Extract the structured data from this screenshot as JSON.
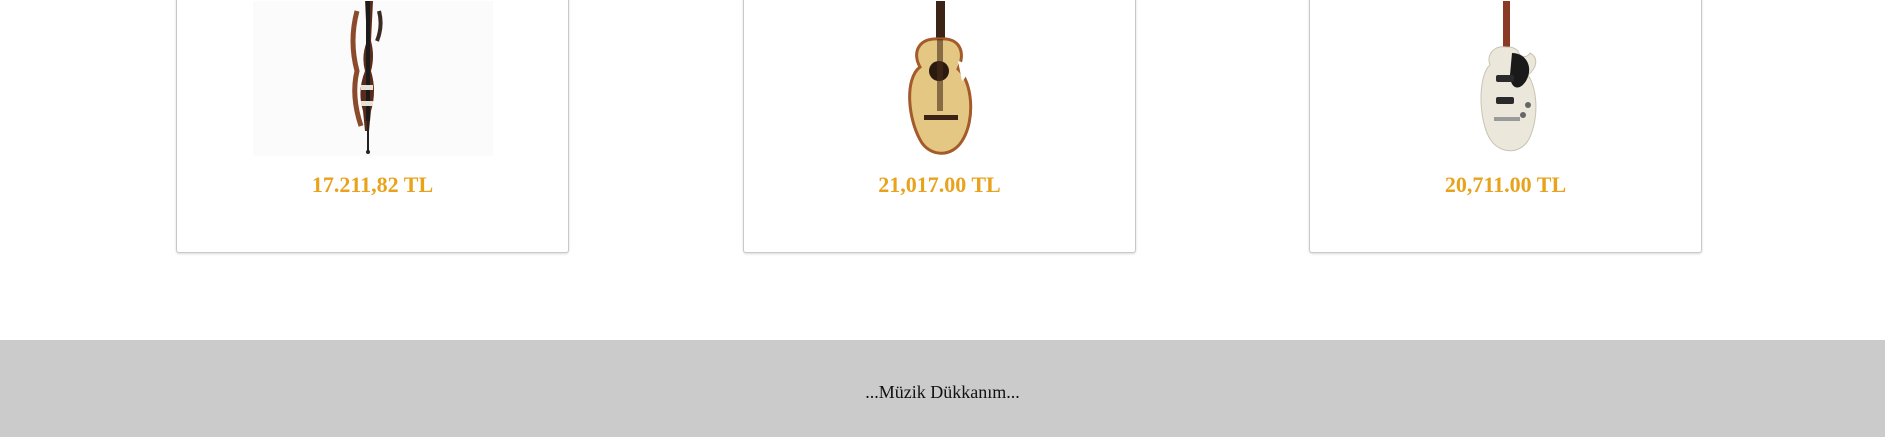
{
  "products": [
    {
      "image": "electric-violin-image",
      "price": "17.211,82 TL"
    },
    {
      "image": "acoustic-guitar-image",
      "price": "21,017.00 TL"
    },
    {
      "image": "electric-guitar-image",
      "price": "20,711.00 TL"
    }
  ],
  "footer": {
    "text": "...Müzik Dükkanım..."
  },
  "colors": {
    "price": "#e9a21b",
    "footer_bg": "#cccbcc"
  }
}
